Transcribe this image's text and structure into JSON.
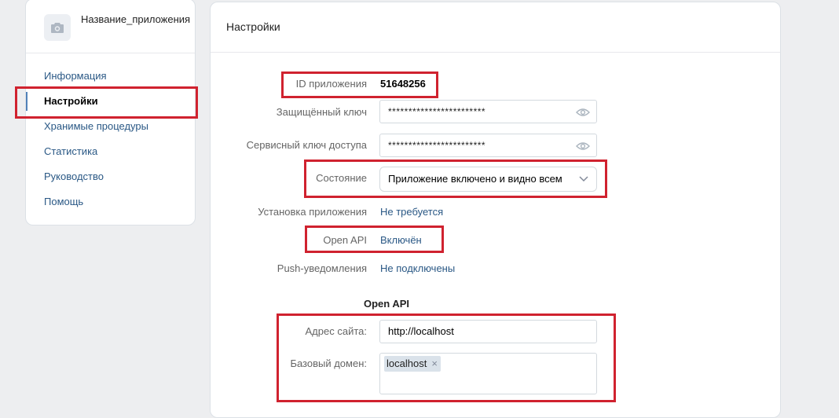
{
  "sidebar": {
    "app_name": "Название_приложения",
    "app_icon": "camera-icon",
    "items": [
      {
        "label": "Информация"
      },
      {
        "label": "Настройки",
        "active": true
      },
      {
        "label": "Хранимые процедуры"
      },
      {
        "label": "Статистика"
      },
      {
        "label": "Руководство"
      },
      {
        "label": "Помощь"
      }
    ]
  },
  "main": {
    "title": "Настройки",
    "app_id": {
      "label": "ID приложения",
      "value": "51648256"
    },
    "secure_key": {
      "label": "Защищённый ключ",
      "value": "************************"
    },
    "service_key": {
      "label": "Сервисный ключ доступа",
      "value": "************************"
    },
    "state": {
      "label": "Состояние",
      "value": "Приложение включено и видно всем"
    },
    "install": {
      "label": "Установка приложения",
      "value": "Не требуется"
    },
    "open_api": {
      "label": "Open API",
      "value": "Включён"
    },
    "push": {
      "label": "Push-уведомления",
      "value": "Не подключены"
    },
    "open_api_section": {
      "title": "Open API",
      "site_label": "Адрес сайта:",
      "site_value": "http://localhost",
      "domain_label": "Базовый домен:",
      "domain_tag": "localhost",
      "remove_tag_glyph": "×"
    }
  },
  "colors": {
    "accent": "#5181b8",
    "link": "#2a5885",
    "highlight": "#d0222f",
    "background": "#edeef0"
  }
}
